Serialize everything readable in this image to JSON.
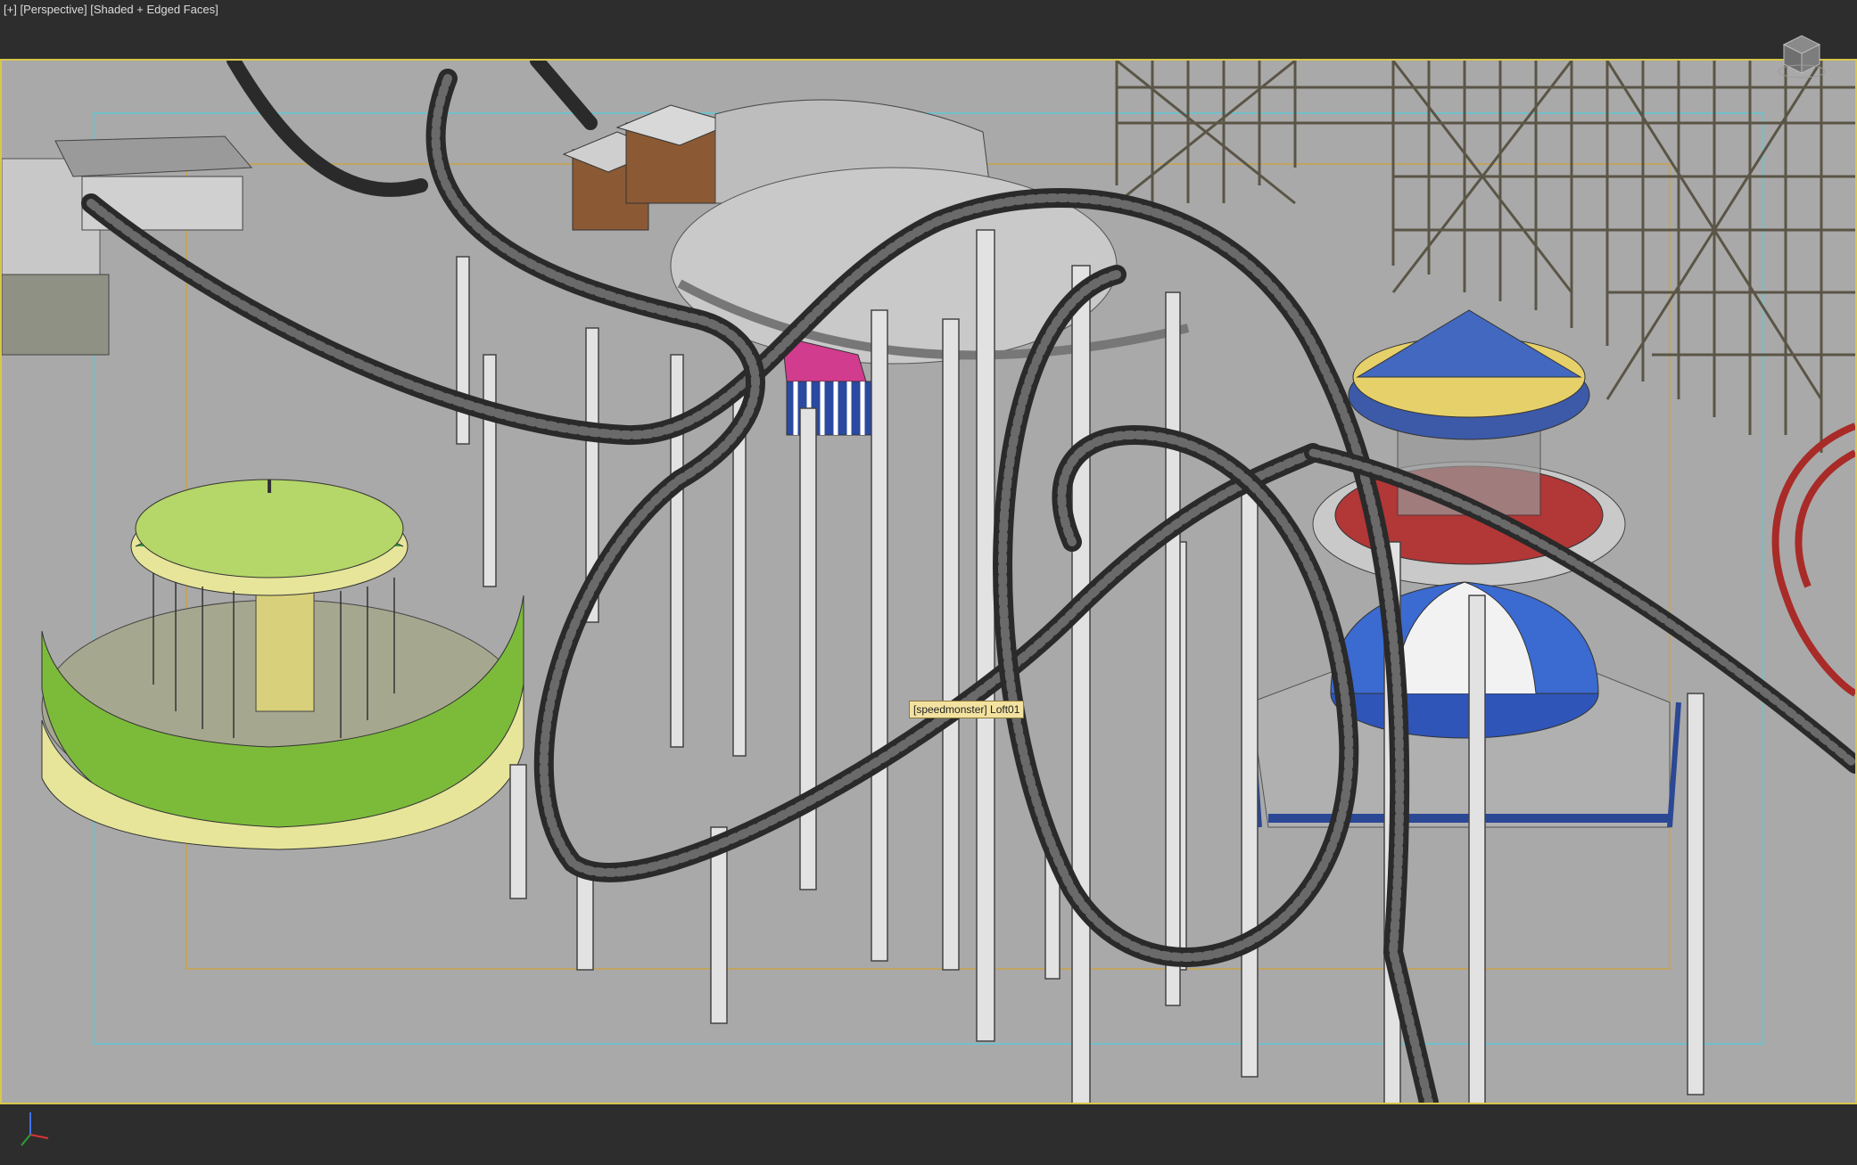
{
  "viewport": {
    "label_plus": "[+]",
    "label_view": "[Perspective]",
    "label_shading": "[Shaded + Edged Faces]",
    "tooltip": "[speedmonster] Loft01"
  },
  "icons": {
    "viewcube": "viewcube-icon",
    "axis": "axis-tripod-icon"
  },
  "colors": {
    "background": "#2d2d2d",
    "viewport_bg": "#a9a9a9",
    "active_border": "#d7c64a",
    "safe_frame_outer": "#5fc8d6",
    "safe_frame_inner": "#c9a24a"
  }
}
